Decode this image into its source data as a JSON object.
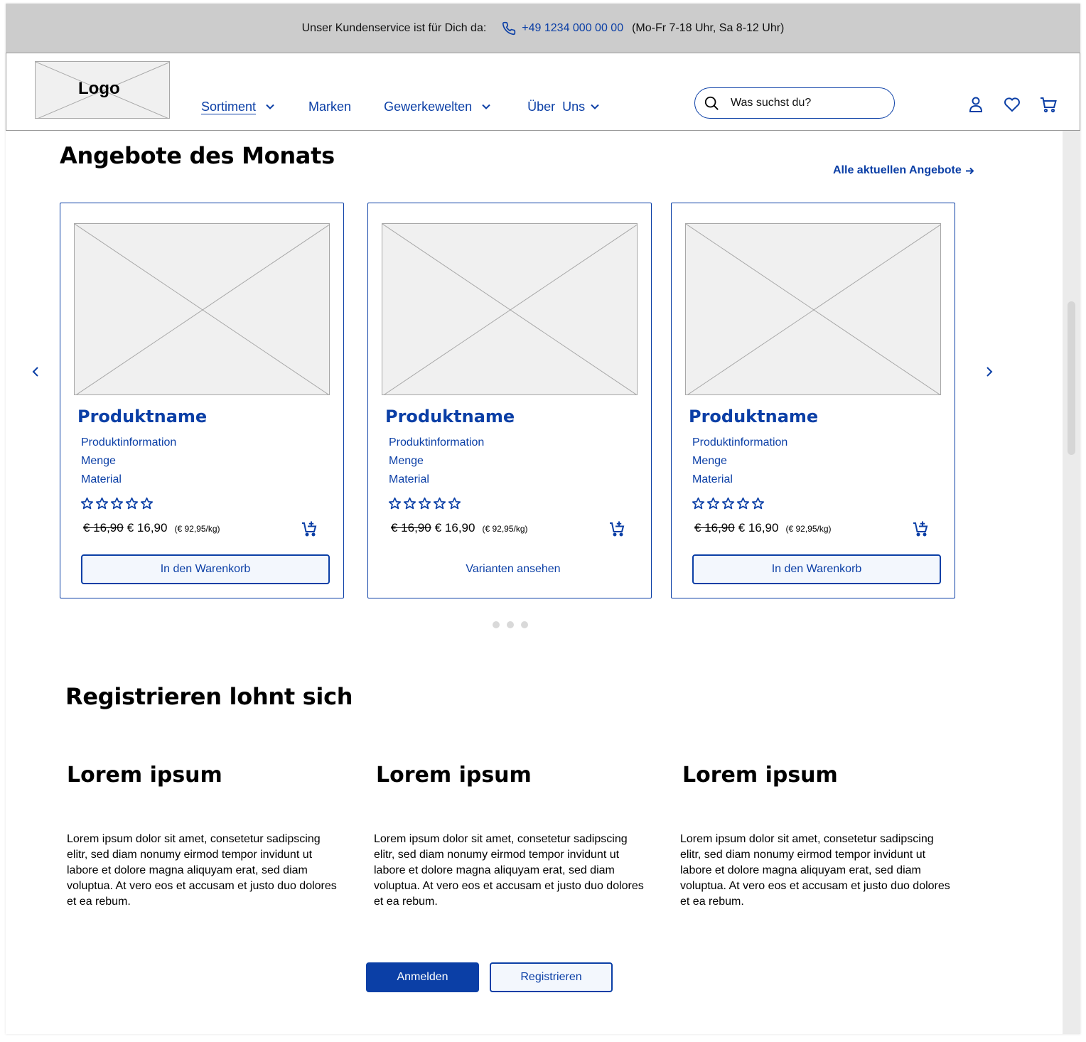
{
  "service_bar": {
    "label": "Unser Kundenservice ist für Dich da:",
    "phone": "+49 1234 000 00 00",
    "hours": "(Mo-Fr 7-18 Uhr, Sa 8-12 Uhr)"
  },
  "header": {
    "logo_text": "Logo",
    "nav": [
      {
        "label": "Sortiment",
        "has_dropdown": true,
        "active": true
      },
      {
        "label": "Marken",
        "has_dropdown": false,
        "active": false
      },
      {
        "label": "Gewerkewelten",
        "has_dropdown": true,
        "active": false
      },
      {
        "label": "Über  Uns",
        "has_dropdown": true,
        "active": false
      }
    ],
    "search_placeholder": "Was suchst du?",
    "icons": [
      "user-icon",
      "heart-icon",
      "cart-icon"
    ]
  },
  "offers": {
    "title": "Angebote des Monats",
    "all_link": "Alle aktuellen Angebote",
    "products": [
      {
        "name": "Produktname",
        "info": "Produktinformation",
        "quantity": "Menge",
        "material": "Material",
        "rating": 0,
        "old_price": "€ 16,90",
        "price": "€ 16,90",
        "unit_price": "(€ 92,95/kg)",
        "button": "In den Warenkorb",
        "button_style": "outlined"
      },
      {
        "name": "Produktname",
        "info": "Produktinformation",
        "quantity": "Menge",
        "material": "Material",
        "rating": 0,
        "old_price": "€ 16,90",
        "price": "€ 16,90",
        "unit_price": "(€ 92,95/kg)",
        "button": "Varianten ansehen",
        "button_style": "plain"
      },
      {
        "name": "Produktname",
        "info": "Produktinformation",
        "quantity": "Menge",
        "material": "Material",
        "rating": 0,
        "old_price": "€ 16,90",
        "price": "€ 16,90",
        "unit_price": "(€ 92,95/kg)",
        "button": "In den Warenkorb",
        "button_style": "outlined"
      }
    ],
    "pagination_dots": 3
  },
  "register": {
    "title": "Registrieren lohnt sich",
    "columns": [
      {
        "title": "Lorem ipsum",
        "text": "Lorem ipsum dolor sit amet, consetetur sadipscing elitr, sed diam nonumy eirmod tempor invidunt ut labore et dolore magna aliquyam erat, sed diam voluptua. At vero eos et accusam et justo duo dolores et ea rebum."
      },
      {
        "title": "Lorem ipsum",
        "text": "Lorem ipsum dolor sit amet, consetetur sadipscing elitr, sed diam nonumy eirmod tempor invidunt ut labore et dolore magna aliquyam erat, sed diam voluptua. At vero eos et accusam et justo duo dolores et ea rebum."
      },
      {
        "title": "Lorem ipsum",
        "text": "Lorem ipsum dolor sit amet, consetetur sadipscing elitr, sed diam nonumy eirmod tempor invidunt ut labore et dolore magna aliquyam erat, sed diam voluptua. At vero eos et accusam et justo duo dolores et ea rebum."
      }
    ],
    "login_button": "Anmelden",
    "register_button": "Registrieren"
  },
  "colors": {
    "brand_blue": "#0b3fa6",
    "service_bar_bg": "#cccccc",
    "placeholder_bg": "#f0f0f0"
  }
}
